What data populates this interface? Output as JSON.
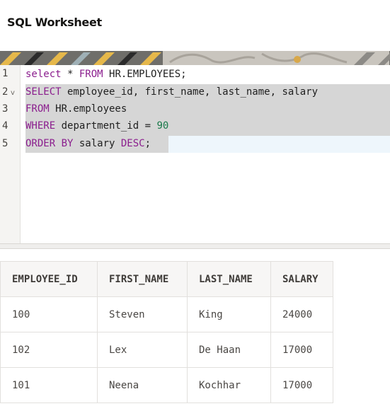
{
  "header": {
    "title": "SQL Worksheet"
  },
  "editor": {
    "line_numbers": [
      "1",
      "2",
      "3",
      "4",
      "5"
    ],
    "fold_marker": "v",
    "lines": [
      [
        {
          "t": "select",
          "k": "kw"
        },
        {
          "t": " * ",
          "k": ""
        },
        {
          "t": "FROM",
          "k": "kw"
        },
        {
          "t": " HR.EMPLOYEES;",
          "k": ""
        }
      ],
      [
        {
          "t": "SELECT",
          "k": "kw"
        },
        {
          "t": " employee_id, first_name, last_name, salary",
          "k": ""
        }
      ],
      [
        {
          "t": "FROM",
          "k": "kw"
        },
        {
          "t": " HR.employees",
          "k": ""
        }
      ],
      [
        {
          "t": "WHERE",
          "k": "kw"
        },
        {
          "t": " department_id = ",
          "k": ""
        },
        {
          "t": "90",
          "k": "num"
        }
      ],
      [
        {
          "t": "ORDER BY",
          "k": "kw"
        },
        {
          "t": " salary ",
          "k": ""
        },
        {
          "t": "DESC",
          "k": "kw"
        },
        {
          "t": ";",
          "k": ""
        }
      ]
    ]
  },
  "results": {
    "columns": [
      "EMPLOYEE_ID",
      "FIRST_NAME",
      "LAST_NAME",
      "SALARY"
    ],
    "rows": [
      [
        "100",
        "Steven",
        "King",
        "24000"
      ],
      [
        "102",
        "Lex",
        "De Haan",
        "17000"
      ],
      [
        "101",
        "Neena",
        "Kochhar",
        "17000"
      ]
    ]
  },
  "colors": {
    "keyword": "#8b1e8e",
    "number": "#1a7a4a",
    "selection": "#d6d6d6",
    "current_line": "#eef6fc"
  }
}
